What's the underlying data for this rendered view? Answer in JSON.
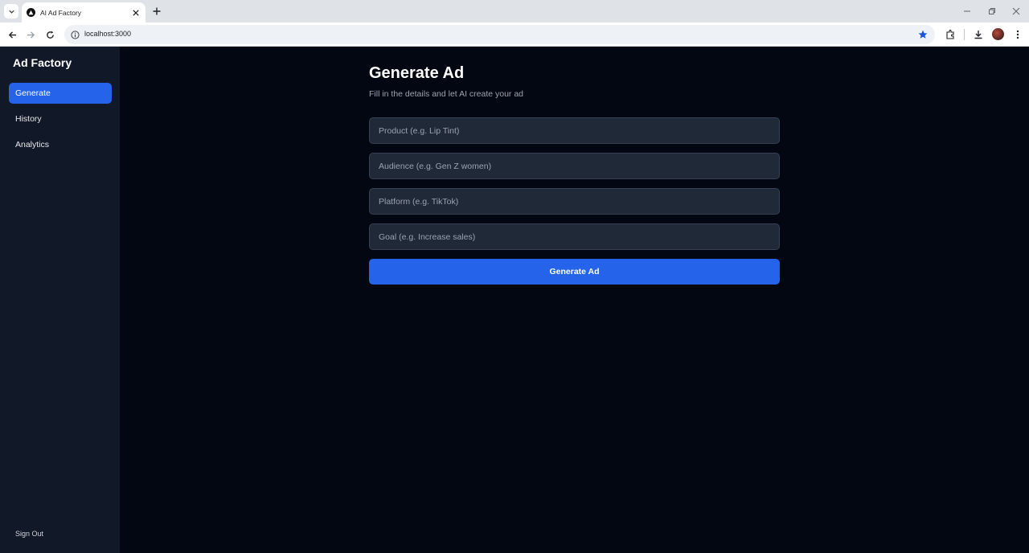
{
  "browser": {
    "tab_title": "AI Ad Factory",
    "url": "localhost:3000"
  },
  "sidebar": {
    "brand": "Ad Factory",
    "items": [
      {
        "label": "Generate",
        "active": true
      },
      {
        "label": "History",
        "active": false
      },
      {
        "label": "Analytics",
        "active": false
      }
    ],
    "sign_out": "Sign Out"
  },
  "main": {
    "title": "Generate Ad",
    "subtitle": "Fill in the details and let AI create your ad",
    "fields": [
      {
        "placeholder": "Product (e.g. Lip Tint)",
        "value": ""
      },
      {
        "placeholder": "Audience (e.g. Gen Z women)",
        "value": ""
      },
      {
        "placeholder": "Platform (e.g. TikTok)",
        "value": ""
      },
      {
        "placeholder": "Goal (e.g. Increase sales)",
        "value": ""
      }
    ],
    "submit_label": "Generate Ad"
  },
  "colors": {
    "accent": "#2563eb",
    "sidebar_bg": "#111827",
    "page_bg": "#030712",
    "input_bg": "#1f2937"
  },
  "icons": [
    "tab-search-icon",
    "favicon-icon",
    "close-icon",
    "plus-icon",
    "minimize-icon",
    "restore-icon",
    "back-arrow-icon",
    "forward-arrow-icon",
    "reload-icon",
    "info-icon",
    "star-icon",
    "extensions-icon",
    "download-icon",
    "kebab-menu-icon"
  ]
}
